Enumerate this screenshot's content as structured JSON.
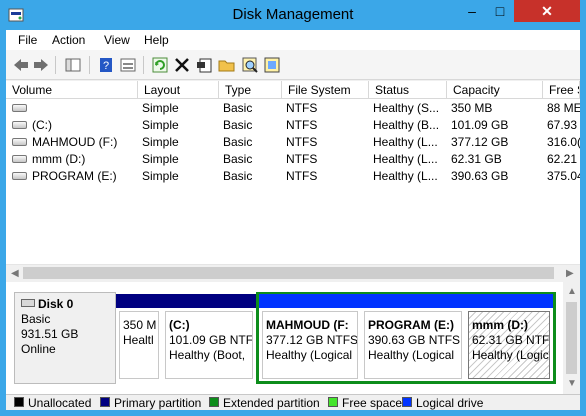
{
  "window": {
    "title": "Disk Management",
    "controls": {
      "minimize": "–",
      "maximize": "□",
      "close": "✕"
    }
  },
  "menu": [
    "File",
    "Action",
    "View",
    "Help"
  ],
  "toolbar": {
    "icons": [
      "back-icon",
      "forward-icon",
      "show-hide-tree-icon",
      "help-icon",
      "properties-icon",
      "refresh-icon",
      "delete-icon",
      "properties-sheet-icon",
      "open-folder-icon",
      "search-icon",
      "format-icon"
    ]
  },
  "volumes": {
    "columns": [
      "Volume",
      "Layout",
      "Type",
      "File System",
      "Status",
      "Capacity",
      "Free S"
    ],
    "rows": [
      [
        "",
        "Simple",
        "Basic",
        "NTFS",
        "Healthy (S...",
        "350 MB",
        "88 ME"
      ],
      [
        "(C:)",
        "Simple",
        "Basic",
        "NTFS",
        "Healthy (B...",
        "101.09 GB",
        "67.93"
      ],
      [
        "MAHMOUD (F:)",
        "Simple",
        "Basic",
        "NTFS",
        "Healthy (L...",
        "377.12 GB",
        "316.0("
      ],
      [
        "mmm (D:)",
        "Simple",
        "Basic",
        "NTFS",
        "Healthy (L...",
        "62.31 GB",
        "62.21"
      ],
      [
        "PROGRAM (E:)",
        "Simple",
        "Basic",
        "NTFS",
        "Healthy (L...",
        "390.63 GB",
        "375.04"
      ]
    ]
  },
  "disk": {
    "name": "Disk 0",
    "type": "Basic",
    "size": "931.51 GB",
    "state": "Online"
  },
  "partitions": [
    {
      "name": "",
      "size": "350 M",
      "status": "Healtl",
      "bar_color": "#000080"
    },
    {
      "name": "(C:)",
      "size": "101.09 GB NTFS",
      "status": "Healthy (Boot,",
      "bar_color": "#000080"
    },
    {
      "name": "MAHMOUD (F:",
      "size": "377.12 GB NTFS",
      "status": "Healthy (Logical",
      "bar_color": "#0033ff"
    },
    {
      "name": "PROGRAM (E:)",
      "size": "390.63 GB NTFS",
      "status": "Healthy (Logical",
      "bar_color": "#0033ff"
    },
    {
      "name": "mmm (D:)",
      "size": "62.31 GB NTFS",
      "status": "Healthy (Logic",
      "bar_color": "#0033ff"
    }
  ],
  "legend": [
    {
      "label": "Unallocated",
      "color": "#000000"
    },
    {
      "label": "Primary partition",
      "color": "#000080"
    },
    {
      "label": "Extended partition",
      "color": "#0d8d1b"
    },
    {
      "label": "Free space",
      "color": "#45e52d"
    },
    {
      "label": "Logical drive",
      "color": "#0033ff"
    }
  ]
}
